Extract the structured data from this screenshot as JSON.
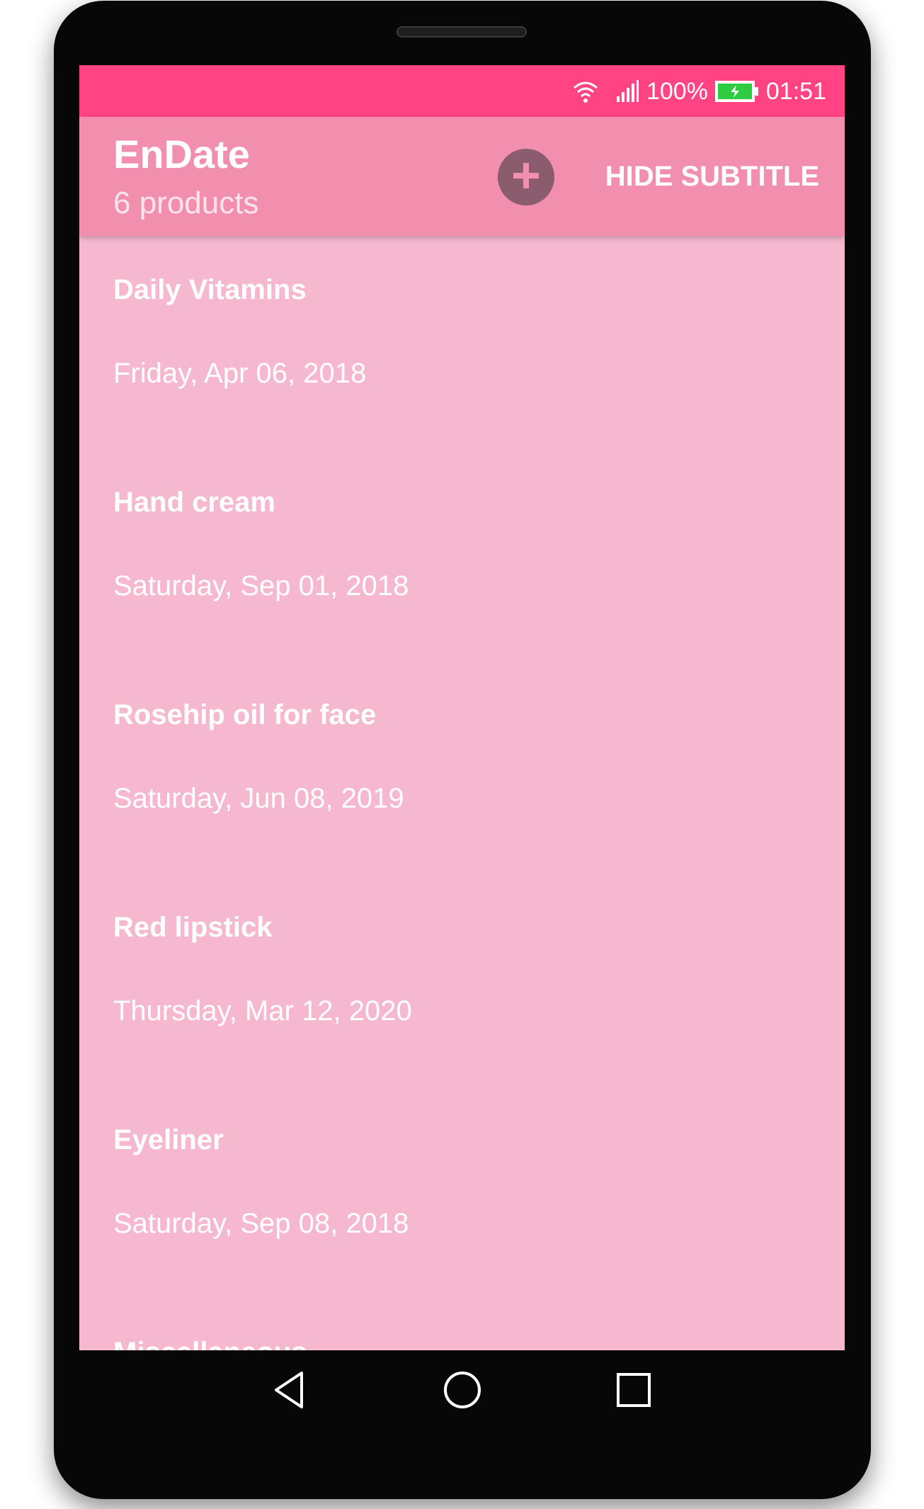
{
  "status_bar": {
    "battery": "100%",
    "time": "01:51",
    "icons": [
      "wifi-icon",
      "signal-icon",
      "battery-charging-icon"
    ]
  },
  "app_bar": {
    "title": "EnDate",
    "subtitle": "6 products",
    "add_icon": "plus-icon",
    "hide_subtitle_label": "HIDE SUBTITLE"
  },
  "products": [
    {
      "name": "Daily Vitamins",
      "date": "Friday, Apr 06, 2018"
    },
    {
      "name": "Hand cream",
      "date": "Saturday, Sep 01, 2018"
    },
    {
      "name": "Rosehip oil for face",
      "date": "Saturday, Jun 08, 2019"
    },
    {
      "name": "Red lipstick",
      "date": "Thursday, Mar 12, 2020"
    },
    {
      "name": "Eyeliner",
      "date": "Saturday, Sep 08, 2018"
    },
    {
      "name": "Miscellaneous",
      "date": ""
    }
  ],
  "nav_bar": {
    "icons": [
      "back-icon",
      "home-icon",
      "recents-icon"
    ]
  },
  "colors": {
    "status_bar": "#ff4383",
    "app_bar": "#f28fae",
    "list_background": "#f6b8ce",
    "add_button": "#8a5c6e"
  }
}
